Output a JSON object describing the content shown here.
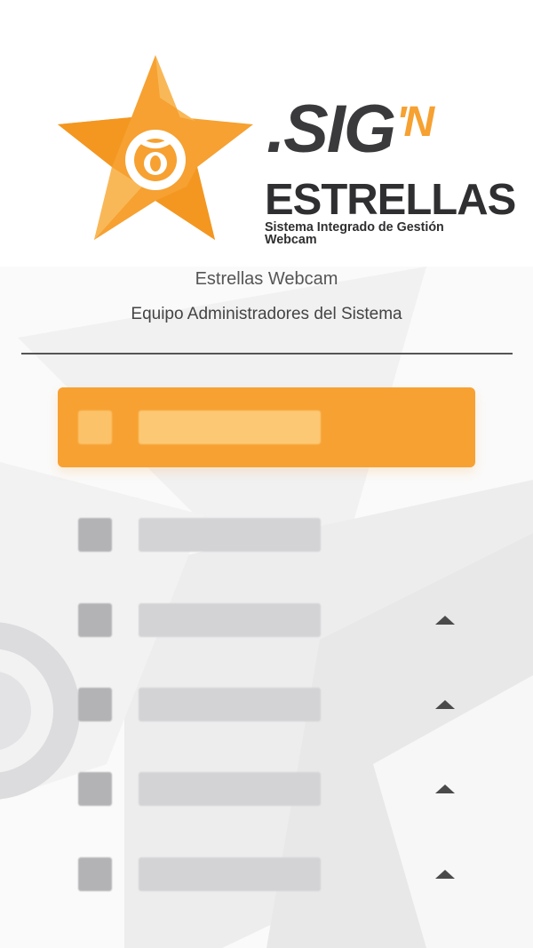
{
  "brand": {
    "word": ".SIG",
    "word_accent": "'N",
    "name": "ESTRELLAS",
    "tagline": "Sistema Integrado de Gestión Webcam",
    "primary_color": "#f6a131",
    "dark_color": "#3a3a3c"
  },
  "header": {
    "title": "Estrellas Webcam",
    "subtitle": "Equipo Administradores del Sistema"
  },
  "menu": {
    "items": [
      {
        "label": "",
        "icon": "menu-item-icon",
        "active": true,
        "expandable": false
      },
      {
        "label": "",
        "icon": "menu-item-icon",
        "active": false,
        "expandable": false
      },
      {
        "label": "",
        "icon": "menu-item-icon",
        "active": false,
        "expandable": true
      },
      {
        "label": "",
        "icon": "menu-item-icon",
        "active": false,
        "expandable": true
      },
      {
        "label": "",
        "icon": "menu-item-icon",
        "active": false,
        "expandable": true
      },
      {
        "label": "",
        "icon": "menu-item-icon",
        "active": false,
        "expandable": true
      }
    ]
  },
  "icons": {
    "expand": "chevron-up-icon",
    "logo": "star-webcam-logo-icon"
  }
}
